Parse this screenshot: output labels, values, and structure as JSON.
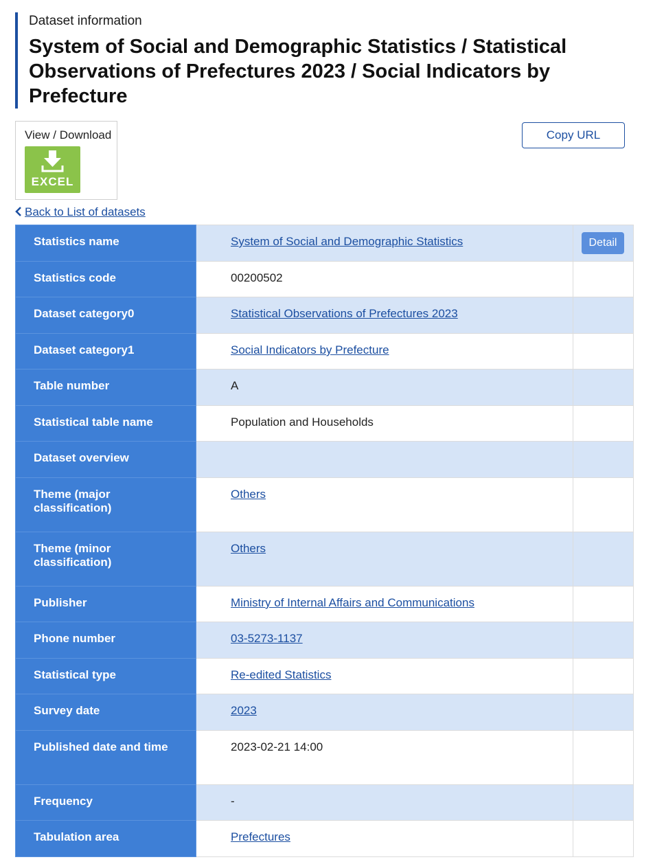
{
  "header": {
    "kicker": "Dataset information",
    "title": "System of Social and Demographic Statistics / Statistical Observations of Prefectures 2023 / Social Indicators by Prefecture"
  },
  "download": {
    "label": "View / Download",
    "excel_label": "EXCEL",
    "icon": "download-icon",
    "color": "#8bc34a"
  },
  "copy_url_label": "Copy URL",
  "back_link_label": "Back to List of datasets",
  "detail_label": "Detail",
  "colors": {
    "accent": "#1c4fa1",
    "header_cell": "#3e7fd6",
    "row_alt": "#d6e4f7"
  },
  "rows": [
    {
      "label": "Statistics name",
      "value": "System of Social and Demographic Statistics",
      "link": true
    },
    {
      "label": "Statistics code",
      "value": "00200502",
      "link": false
    },
    {
      "label": "Dataset category0",
      "value": "Statistical Observations of Prefectures 2023",
      "link": true
    },
    {
      "label": "Dataset category1",
      "value": "Social Indicators by Prefecture",
      "link": true
    },
    {
      "label": "Table number",
      "value": "A",
      "link": false
    },
    {
      "label": "Statistical table name",
      "value": "Population and Households",
      "link": false
    },
    {
      "label": "Dataset overview",
      "value": "",
      "link": false
    },
    {
      "label": "Theme (major classification)",
      "value": "Others",
      "link": true
    },
    {
      "label": "Theme (minor classification)",
      "value": "Others",
      "link": true
    },
    {
      "label": "Publisher",
      "value": "Ministry of Internal Affairs and Communications",
      "link": true
    },
    {
      "label": "Phone number",
      "value": "03-5273-1137",
      "link": true
    },
    {
      "label": "Statistical type",
      "value": "Re-edited Statistics",
      "link": true
    },
    {
      "label": "Survey date",
      "value": "2023",
      "link": true
    },
    {
      "label": "Published date and time",
      "value": "2023-02-21 14:00",
      "link": false
    },
    {
      "label": "Frequency",
      "value": "-",
      "link": false
    },
    {
      "label": "Tabulation area",
      "value": "Prefectures",
      "link": true
    }
  ]
}
